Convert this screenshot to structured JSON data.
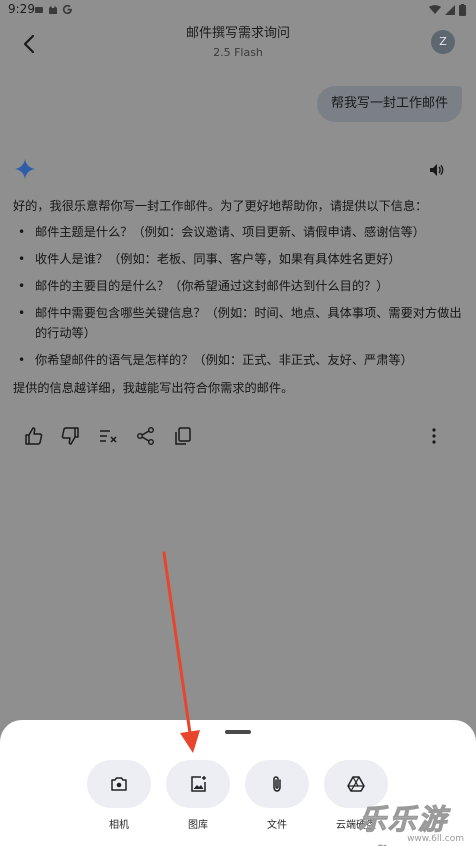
{
  "status_bar": {
    "time": "9:29"
  },
  "header": {
    "title": "邮件撰写需求询问",
    "subtitle": "2.5 Flash",
    "avatar_letter": "Z"
  },
  "user_message": "帮我写一封工作邮件",
  "response": {
    "intro": "好的，我很乐意帮你写一封工作邮件。为了更好地帮助你，请提供以下信息：",
    "bullets": [
      "邮件主题是什么？（例如：会议邀请、项目更新、请假申请、感谢信等）",
      "收件人是谁？（例如：老板、同事、客户等，如果有具体姓名更好）",
      "邮件的主要目的是什么？（你希望通过这封邮件达到什么目的？）",
      "邮件中需要包含哪些关键信息？（例如：时间、地点、具体事项、需要对方做出的行动等）",
      "你希望邮件的语气是怎样的？（例如：正式、非正式、友好、严肃等）"
    ],
    "closing": "提供的信息越详细，我越能写出符合你需求的邮件。"
  },
  "actions": [
    "thumbs-up-icon",
    "thumbs-down-icon",
    "modify-icon",
    "share-icon",
    "copy-icon",
    "more-icon"
  ],
  "sheet": {
    "buttons": [
      {
        "label": "相机",
        "icon": "camera-icon"
      },
      {
        "label": "图库",
        "icon": "gallery-icon"
      },
      {
        "label": "文件",
        "icon": "attach-icon"
      },
      {
        "label": "云端硬盘",
        "icon": "drive-icon"
      }
    ]
  },
  "watermark": {
    "text": "乐乐游戏",
    "url": "www.6ll.com"
  },
  "colors": {
    "arrow": "#e8452c",
    "sheet_bg": "#ffffff",
    "overlay": "#8f8f8f"
  }
}
